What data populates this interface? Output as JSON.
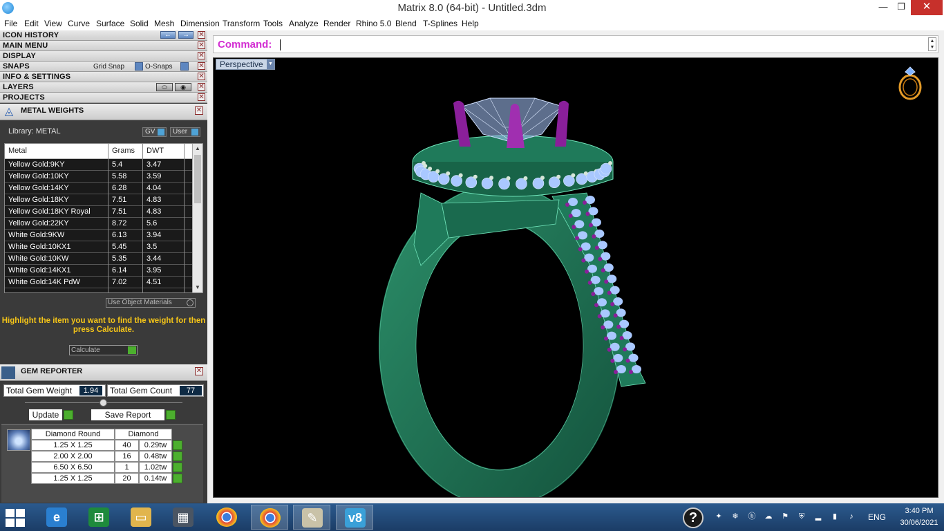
{
  "window": {
    "title": "Matrix 8.0 (64-bit) - Untitled.3dm",
    "minimize": "—",
    "maximize": "❐",
    "close": "✕"
  },
  "menu": [
    "File",
    "Edit",
    "View",
    "Curve",
    "Surface",
    "Solid",
    "Mesh",
    "Dimension",
    "Transform",
    "Tools",
    "Analyze",
    "Render",
    "Rhino 5.0",
    "Blend",
    "T-Splines",
    "Help"
  ],
  "panels": {
    "icon_history": "ICON HISTORY",
    "main_menu": "MAIN MENU",
    "display": "DISPLAY",
    "snaps": "SNAPS",
    "grid_snap": "Grid Snap",
    "o_snaps": "O-Snaps",
    "info_settings": "INFO & SETTINGS",
    "layers": "LAYERS",
    "projects": "PROJECTS",
    "close_glyph": "✕",
    "back_glyph": "←",
    "forward_glyph": "→"
  },
  "metal_weights": {
    "title": "METAL WEIGHTS",
    "library_label": "Library: METAL",
    "gv_label": "GV",
    "user_label": "User",
    "columns": [
      "Metal",
      "Grams",
      "DWT"
    ],
    "rows": [
      [
        "Yellow Gold:9KY",
        "5.4",
        "3.47"
      ],
      [
        "Yellow Gold:10KY",
        "5.58",
        "3.59"
      ],
      [
        "Yellow Gold:14KY",
        "6.28",
        "4.04"
      ],
      [
        "Yellow Gold:18KY",
        "7.51",
        "4.83"
      ],
      [
        "Yellow Gold:18KY Royal",
        "7.51",
        "4.83"
      ],
      [
        "Yellow Gold:22KY",
        "8.72",
        "5.6"
      ],
      [
        "White Gold:9KW",
        "6.13",
        "3.94"
      ],
      [
        "White Gold:10KX1",
        "5.45",
        "3.5"
      ],
      [
        "White Gold:10KW",
        "5.35",
        "3.44"
      ],
      [
        "White Gold:14KX1",
        "6.14",
        "3.95"
      ],
      [
        "White Gold:14K PdW",
        "7.02",
        "4.51"
      ]
    ],
    "use_object_materials": "Use Object Materials",
    "hint": "Highlight the item you want to find the weight for then press Calculate.",
    "calculate_label": "Calculate"
  },
  "gem_reporter": {
    "title": "GEM REPORTER",
    "total_weight_label": "Total Gem Weight",
    "total_weight_value": "1.94",
    "total_count_label": "Total Gem Count",
    "total_count_value": "77",
    "update_label": "Update",
    "save_report_label": "Save Report",
    "columns": [
      "Diamond Round",
      "Diamond"
    ],
    "rows": [
      [
        "1.25 X 1.25",
        "40",
        "0.29tw"
      ],
      [
        "2.00 X 2.00",
        "16",
        "0.48tw"
      ],
      [
        "6.50 X 6.50",
        "1",
        "1.02tw"
      ],
      [
        "1.25 X 1.25",
        "20",
        "0.14tw"
      ]
    ]
  },
  "command": {
    "label": "Command:",
    "value": ""
  },
  "viewport": {
    "name": "Perspective"
  },
  "taskbar": {
    "lang": "ENG",
    "time": "3:40 PM",
    "date": "30/06/2021",
    "help_glyph": "?",
    "apps": [
      "ie-icon",
      "store-icon",
      "explorer-icon",
      "matrix-icon",
      "chrome-icon",
      "chrome-icon",
      "paint-icon",
      "vectorworks-icon"
    ]
  },
  "colors": {
    "metal": "#1f7a5a",
    "metal_edge": "#6fe3b9",
    "gem": "#a9c8ff",
    "prong": "#8a1f9a",
    "command": "#d22dd2",
    "hint": "#f5c518"
  }
}
